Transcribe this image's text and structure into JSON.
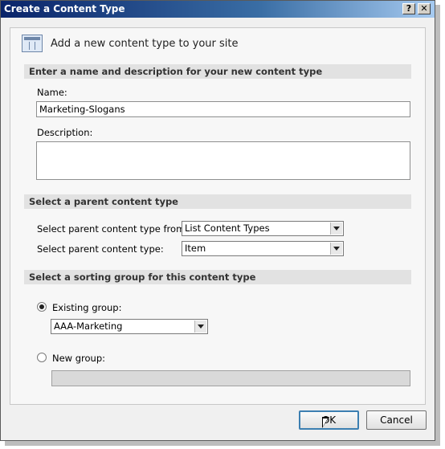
{
  "window": {
    "title": "Create a Content Type",
    "help_glyph": "?",
    "close_glyph": "✕"
  },
  "header": {
    "icon": "content-type-icon",
    "text": "Add a new content type to your site"
  },
  "sections": {
    "name_desc": "Enter a name and description for your new content type",
    "parent": "Select a parent content type",
    "sorting": "Select a sorting group for this content type"
  },
  "fields": {
    "name_label": "Name:",
    "name_value": "Marketing-Slogans",
    "description_label": "Description:",
    "description_value": "",
    "parent_from_label": "Select parent content type from:",
    "parent_from_value": "List Content Types",
    "parent_type_label": "Select parent content type:",
    "parent_type_value": "Item",
    "existing_group_label": "Existing group:",
    "existing_group_value": "AAA-Marketing",
    "existing_group_selected": true,
    "new_group_label": "New group:",
    "new_group_value": ""
  },
  "buttons": {
    "ok": "OK",
    "cancel": "Cancel"
  }
}
